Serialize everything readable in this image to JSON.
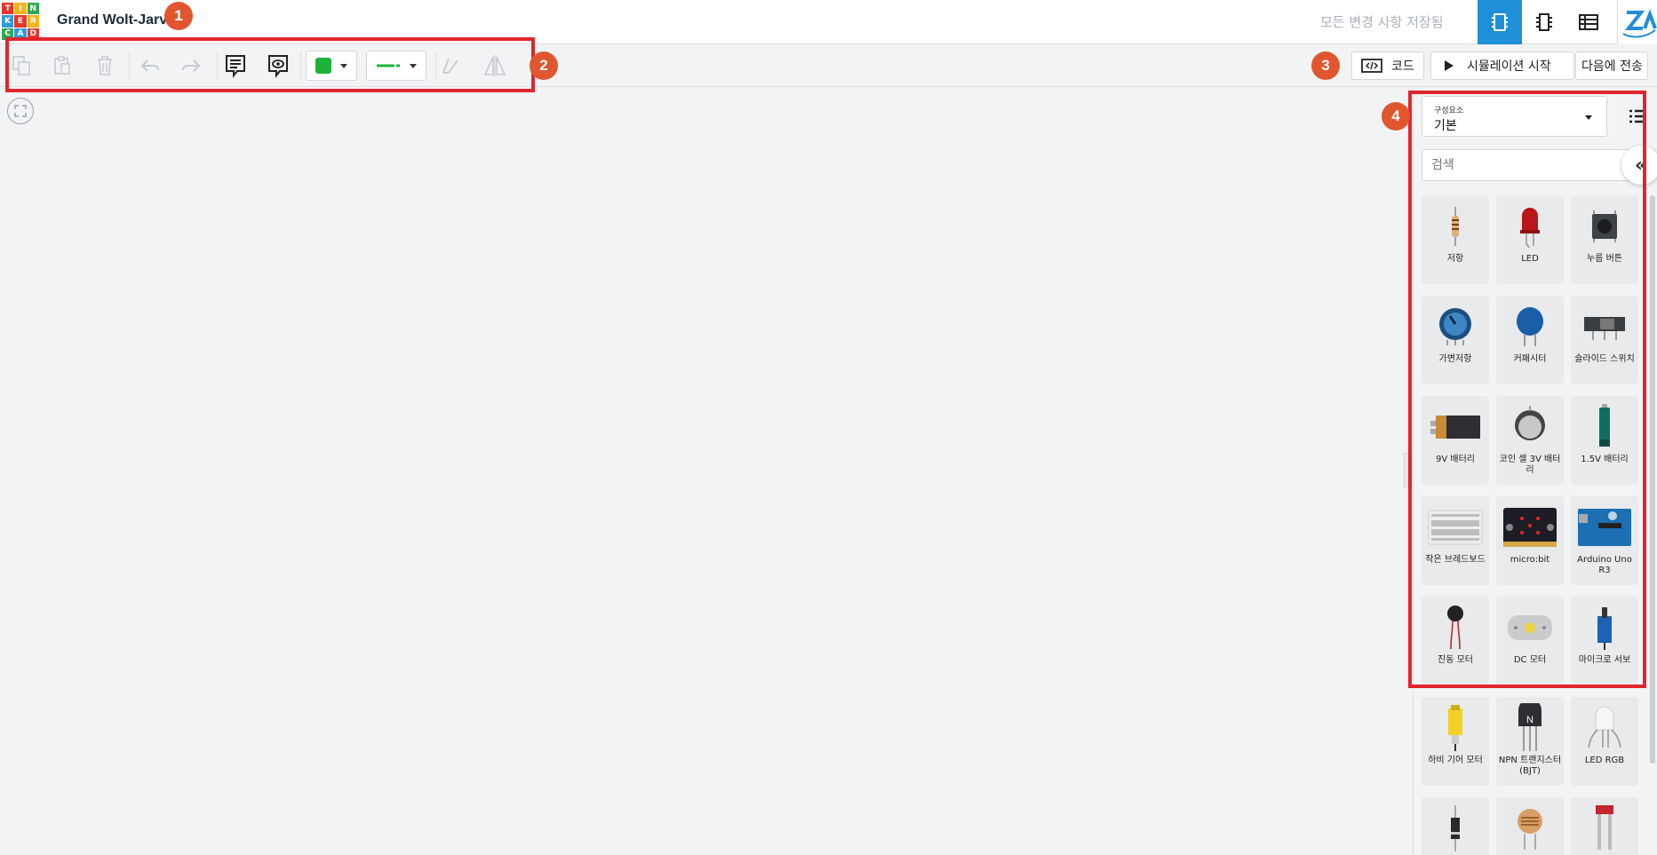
{
  "header": {
    "logo_letters": [
      "T",
      "I",
      "N",
      "K",
      "E",
      "R",
      "C",
      "A",
      "D"
    ],
    "logo_colors": [
      "#e5362b",
      "#f4b41a",
      "#31a853",
      "#2d9cdb",
      "#e5362b",
      "#f4b41a",
      "#31a853",
      "#2d9cdb",
      "#e5362b"
    ],
    "title": "Grand Wolt-Jarv",
    "save_status": "모든 변경 사항 저장됨",
    "views": [
      {
        "icon": "circuit-view-icon",
        "active": true
      },
      {
        "icon": "schematic-view-icon",
        "active": false
      },
      {
        "icon": "component-list-icon",
        "active": false
      }
    ]
  },
  "toolbar": {
    "tools": [
      "copy-icon",
      "paste-icon",
      "delete-icon",
      "undo-icon",
      "redo-icon",
      "note-icon",
      "eye-icon",
      "mirror-icon",
      "flip-icon"
    ],
    "color_swatch": "#1db33a",
    "wire_color": "#1db33a",
    "code_label": "코드",
    "simulate_label": "시뮬레이션 시작",
    "send_label": "다음에 전송"
  },
  "annotations": {
    "badge1": "1",
    "badge2": "2",
    "badge3": "3",
    "badge4": "4",
    "box_color": "#e1252d",
    "badge_color": "#e0572f"
  },
  "panel": {
    "category_small": "구성요소",
    "category_value": "기본",
    "search_placeholder": "검색",
    "components": [
      {
        "name": "저항",
        "icon": "resistor-icon"
      },
      {
        "name": "LED",
        "icon": "led-icon"
      },
      {
        "name": "누름 버튼",
        "icon": "pushbutton-icon"
      },
      {
        "name": "가변저항",
        "icon": "potentiometer-icon"
      },
      {
        "name": "커패시터",
        "icon": "capacitor-icon"
      },
      {
        "name": "슬라이드 스위치",
        "icon": "slide-switch-icon"
      },
      {
        "name": "9V 배터리",
        "icon": "9v-battery-icon"
      },
      {
        "name": "코인 셀 3V 배터리",
        "icon": "coin-cell-icon"
      },
      {
        "name": "1.5V 배터리",
        "icon": "aa-battery-icon"
      },
      {
        "name": "작은 브레드보드",
        "icon": "breadboard-icon"
      },
      {
        "name": "micro:bit",
        "icon": "microbit-icon"
      },
      {
        "name": "Arduino Uno R3",
        "icon": "arduino-icon"
      },
      {
        "name": "진동 모터",
        "icon": "vibration-motor-icon"
      },
      {
        "name": "DC 모터",
        "icon": "dc-motor-icon"
      },
      {
        "name": "마이크로 서보",
        "icon": "micro-servo-icon"
      },
      {
        "name": "하비 기어 모터",
        "icon": "gear-motor-icon"
      },
      {
        "name": "NPN 트랜지스터(BJT)",
        "icon": "npn-transistor-icon"
      },
      {
        "name": "LED RGB",
        "icon": "rgb-led-icon"
      },
      {
        "name": "",
        "icon": "diode-icon"
      },
      {
        "name": "",
        "icon": "photoresistor-icon"
      },
      {
        "name": "",
        "icon": "soil-sensor-icon"
      }
    ],
    "transistor_letter": "N"
  }
}
